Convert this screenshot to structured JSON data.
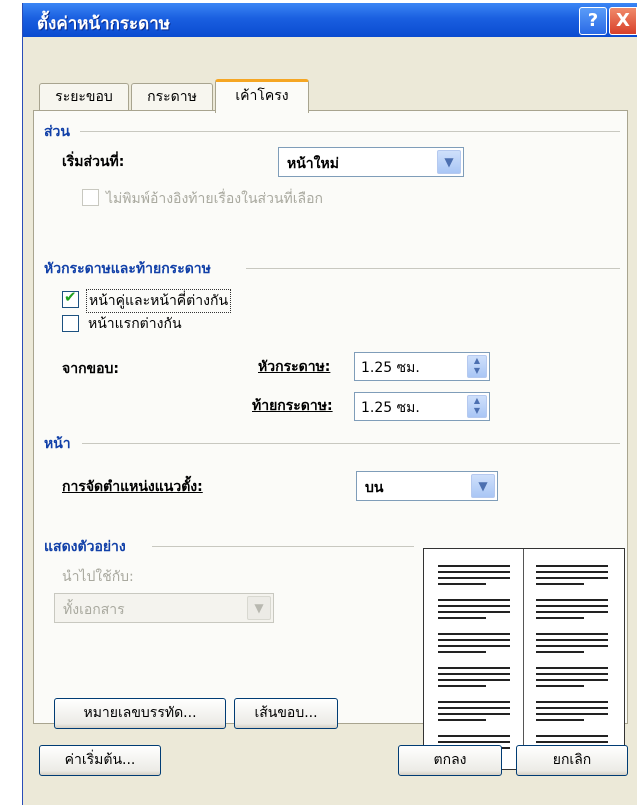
{
  "window": {
    "title": "ตั้งค่าหน้ากระดาษ",
    "help": "?",
    "close": "X"
  },
  "tabs": [
    {
      "label": "ระยะขอบ",
      "active": false
    },
    {
      "label": "กระดาษ",
      "active": false
    },
    {
      "label": "เค้าโครง",
      "active": true
    }
  ],
  "section": {
    "heading": "ส่วน",
    "start_label": "เริ่มส่วนที่:",
    "start_value": "หน้าใหม่",
    "suppress_endnotes": "ไม่พิมพ์อ้างอิงท้ายเรื่องในส่วนที่เลือก"
  },
  "headers_footers": {
    "heading": "หัวกระดาษและท้ายกระดาษ",
    "odd_even": {
      "label": "หน้าคู่และหน้าคี่ต่างกัน",
      "checked": true
    },
    "first_page": {
      "label": "หน้าแรกต่างกัน",
      "checked": false
    },
    "from_edge": "จากขอบ:",
    "header_label": "หัวกระดาษ:",
    "header_value": "1.25 ซม.",
    "footer_label": "ท้ายกระดาษ:",
    "footer_value": "1.25 ซม."
  },
  "page": {
    "heading": "หน้า",
    "valign_label": "การจัดตำแหน่งแนวตั้ง:",
    "valign_value": "บน"
  },
  "preview": {
    "heading": "แสดงตัวอย่าง",
    "apply_label": "นำไปใช้กับ:",
    "apply_value": "ทั้งเอกสาร"
  },
  "buttons": {
    "line_numbers": "หมายเลขบรรทัด...",
    "borders": "เส้นขอบ...",
    "default": "ค่าเริ่มต้น...",
    "ok": "ตกลง",
    "cancel": "ยกเลิก"
  },
  "icons": {
    "dropdown": "chevron-down-icon",
    "spinner": "spin-updown-icon",
    "check": "checkmark-icon"
  },
  "colors": {
    "title_bar": "#0a4bd0",
    "group_heading": "#1140a8",
    "active_tab_accent": "#f5a623",
    "dialog_bg": "#ece9d8"
  }
}
